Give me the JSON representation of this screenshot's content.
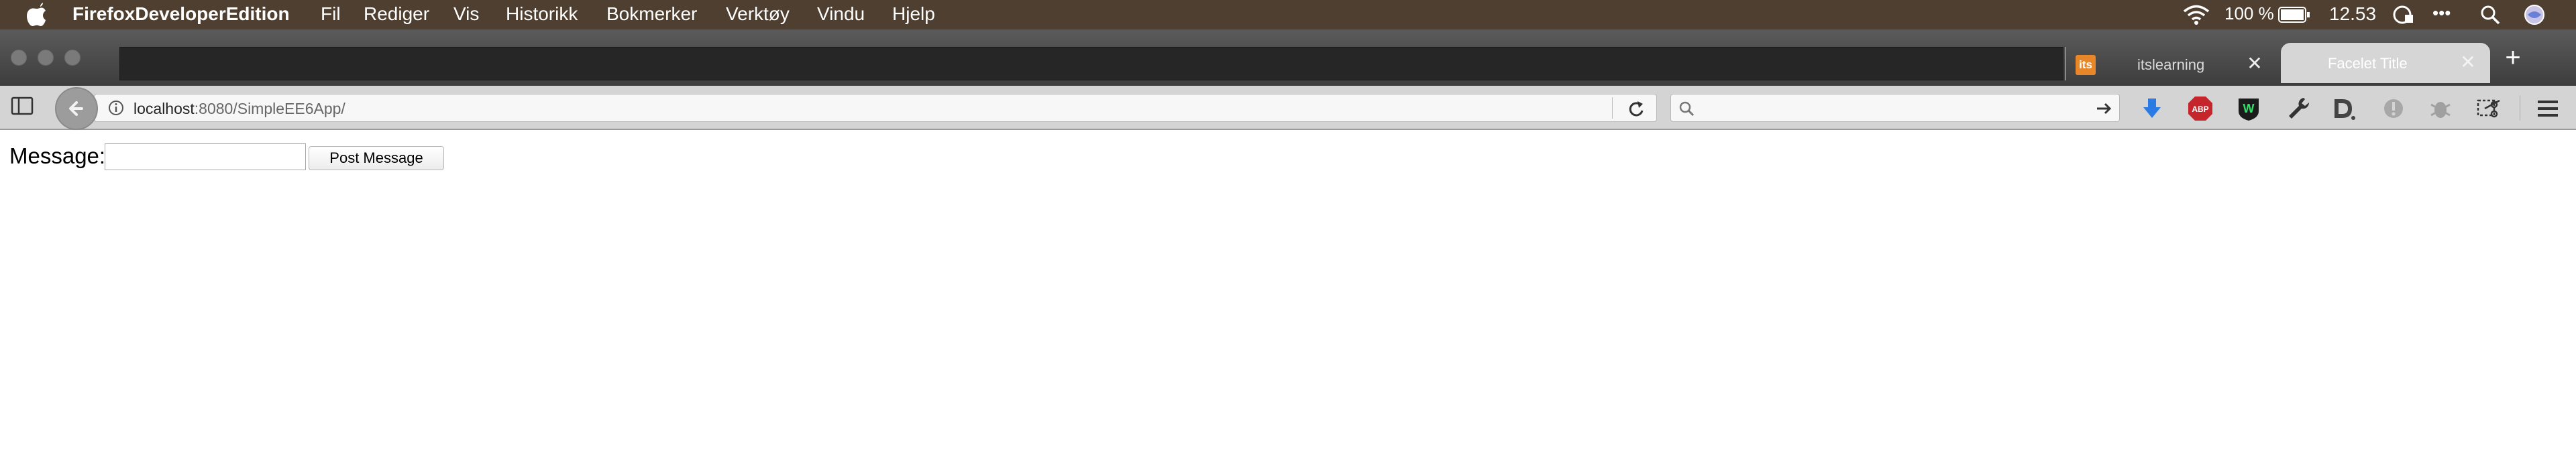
{
  "menubar": {
    "app_name": "FirefoxDeveloperEdition",
    "items": [
      "Fil",
      "Rediger",
      "Vis",
      "Historikk",
      "Bokmerker",
      "Verktøy",
      "Vindu",
      "Hjelp"
    ],
    "battery": "100 %",
    "time": "12.53",
    "more": "•••"
  },
  "tabs": [
    {
      "favicon_text": "its",
      "title": "itslearning",
      "active": false
    },
    {
      "title": "Facelet Title",
      "active": true
    }
  ],
  "toolbar": {
    "url_host": "localhost",
    "url_rest": ":8080/SimpleEE6App/",
    "search_placeholder": "",
    "abp_label": "ABP"
  },
  "form": {
    "label": "Message:",
    "input_value": "",
    "button_label": "Post Message"
  },
  "colors": {
    "menubar": "#4f3f30",
    "download_arrow": "#2a7be4",
    "abp": "#c5262b",
    "tab_favicon": "#e8862a"
  }
}
